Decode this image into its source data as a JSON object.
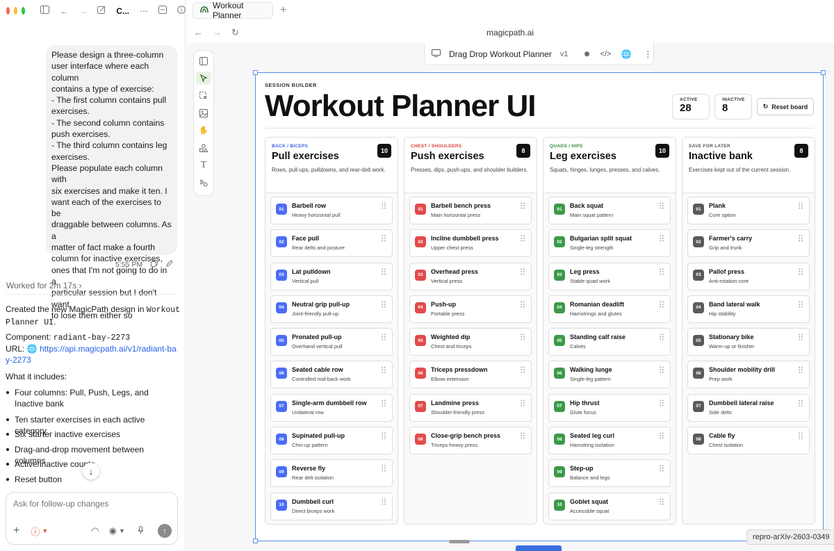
{
  "window": {
    "traffic_lights": [
      "#ff5f57",
      "#febc2e",
      "#28c840"
    ],
    "toolbar_truncated_label": "C..."
  },
  "chat": {
    "user_message": "Please design a three-column\nuser interface where each column\ncontains a type of exercise:\n- The first column contains pull\nexercises.\n- The second column contains\npush exercises.\n- The third column contains leg\nexercises.\nPlease populate each column with\nsix exercises and make it ten. I\nwant each of the exercises to be\ndraggable between columns. As a\nmatter of fact make a fourth\ncolumn for inactive exercises,\nones that I'm not going to do in a\nparticular session but I don't want\nto lose them either so",
    "message_time": "5:55 PM",
    "worked_label": "Worked for 2m 17s",
    "reply_prefix": "Created the new MagicPath design in",
    "reply_design_name": "Workout Planner UI",
    "component_label": "Component:",
    "component_value": "radiant-bay-2273",
    "url_label": "URL:",
    "url_value": "https://api.magicpath.ai/v1/radiant-bay-2273",
    "includes_heading": "What it includes:",
    "bullets": [
      "Four columns: Pull, Push, Legs, and Inactive bank",
      "Ten starter exercises in each active category",
      "Six starter inactive exercises",
      "Drag-and-drop movement between columns",
      "Active/inactive counts",
      "Reset button"
    ],
    "composer_placeholder": "Ask for follow-up changes"
  },
  "browser": {
    "tab_title": "Workout Planner",
    "url": "magicpath.ai",
    "design_name": "Drag Drop Workout Planner",
    "design_version": "v1",
    "tooltip": "repro-arXiv-2603-0349"
  },
  "app": {
    "eyebrow": "SESSION BUILDER",
    "title": "Workout Planner UI",
    "active_label": "ACTIVE",
    "active_count": "28",
    "inactive_label": "INACTIVE",
    "inactive_count": "8",
    "reset_label": "Reset board",
    "columns": [
      {
        "category": "BACK / BICEPS",
        "category_color": "#3b5fe0",
        "title": "Pull exercises",
        "count": "10",
        "description": "Rows, pull-ups, pulldowns, and rear-delt work.",
        "accent": "#4a6cf7",
        "items": [
          {
            "num": "01",
            "name": "Barbell row",
            "detail": "Heavy horizontal pull"
          },
          {
            "num": "02",
            "name": "Face pull",
            "detail": "Rear delts and posture"
          },
          {
            "num": "03",
            "name": "Lat pulldown",
            "detail": "Vertical pull"
          },
          {
            "num": "04",
            "name": "Neutral grip pull-up",
            "detail": "Joint-friendly pull-up"
          },
          {
            "num": "05",
            "name": "Pronated pull-up",
            "detail": "Overhand vertical pull"
          },
          {
            "num": "06",
            "name": "Seated cable row",
            "detail": "Controlled mid-back work"
          },
          {
            "num": "07",
            "name": "Single-arm dumbbell row",
            "detail": "Unilateral row"
          },
          {
            "num": "08",
            "name": "Supinated pull-up",
            "detail": "Chin-up pattern"
          },
          {
            "num": "09",
            "name": "Reverse fly",
            "detail": "Rear delt isolation"
          },
          {
            "num": "10",
            "name": "Dumbbell curl",
            "detail": "Direct biceps work"
          }
        ]
      },
      {
        "category": "CHEST / SHOULDERS",
        "category_color": "#d93a3a",
        "title": "Push exercises",
        "count": "8",
        "description": "Presses, dips, push-ups, and shoulder builders.",
        "accent": "#e24a4a",
        "items": [
          {
            "num": "01",
            "name": "Barbell bench press",
            "detail": "Main horizontal press"
          },
          {
            "num": "02",
            "name": "Incline dumbbell press",
            "detail": "Upper chest press"
          },
          {
            "num": "03",
            "name": "Overhead press",
            "detail": "Vertical press"
          },
          {
            "num": "04",
            "name": "Push-up",
            "detail": "Portable press"
          },
          {
            "num": "05",
            "name": "Weighted dip",
            "detail": "Chest and triceps"
          },
          {
            "num": "06",
            "name": "Triceps pressdown",
            "detail": "Elbow extension"
          },
          {
            "num": "07",
            "name": "Landmine press",
            "detail": "Shoulder-friendly press"
          },
          {
            "num": "08",
            "name": "Close-grip bench press",
            "detail": "Triceps-heavy press"
          }
        ]
      },
      {
        "category": "QUADS / HIPS",
        "category_color": "#2e8b3a",
        "title": "Leg exercises",
        "count": "10",
        "description": "Squats, hinges, lunges, presses, and calves.",
        "accent": "#3a9a48",
        "items": [
          {
            "num": "01",
            "name": "Back squat",
            "detail": "Main squat pattern"
          },
          {
            "num": "02",
            "name": "Bulgarian split squat",
            "detail": "Single-leg strength"
          },
          {
            "num": "03",
            "name": "Leg press",
            "detail": "Stable quad work"
          },
          {
            "num": "04",
            "name": "Romanian deadlift",
            "detail": "Hamstrings and glutes"
          },
          {
            "num": "05",
            "name": "Standing calf raise",
            "detail": "Calves"
          },
          {
            "num": "06",
            "name": "Walking lunge",
            "detail": "Single-leg pattern"
          },
          {
            "num": "07",
            "name": "Hip thrust",
            "detail": "Glute focus"
          },
          {
            "num": "08",
            "name": "Seated leg curl",
            "detail": "Hamstring isolation"
          },
          {
            "num": "09",
            "name": "Step-up",
            "detail": "Balance and legs"
          },
          {
            "num": "10",
            "name": "Goblet squat",
            "detail": "Accessible squat"
          }
        ]
      },
      {
        "category": "SAVE FOR LATER",
        "category_color": "#555555",
        "title": "Inactive bank",
        "count": "8",
        "description": "Exercises kept out of the current session.",
        "accent": "#5a5a5a",
        "items": [
          {
            "num": "01",
            "name": "Plank",
            "detail": "Core option"
          },
          {
            "num": "02",
            "name": "Farmer's carry",
            "detail": "Grip and trunk"
          },
          {
            "num": "03",
            "name": "Pallof press",
            "detail": "Anti-rotation core"
          },
          {
            "num": "04",
            "name": "Band lateral walk",
            "detail": "Hip stability"
          },
          {
            "num": "05",
            "name": "Stationary bike",
            "detail": "Warm-up or finisher"
          },
          {
            "num": "06",
            "name": "Shoulder mobility drill",
            "detail": "Prep work"
          },
          {
            "num": "07",
            "name": "Dumbbell lateral raise",
            "detail": "Side delts"
          },
          {
            "num": "08",
            "name": "Cable fly",
            "detail": "Chest isolation"
          }
        ]
      }
    ]
  }
}
